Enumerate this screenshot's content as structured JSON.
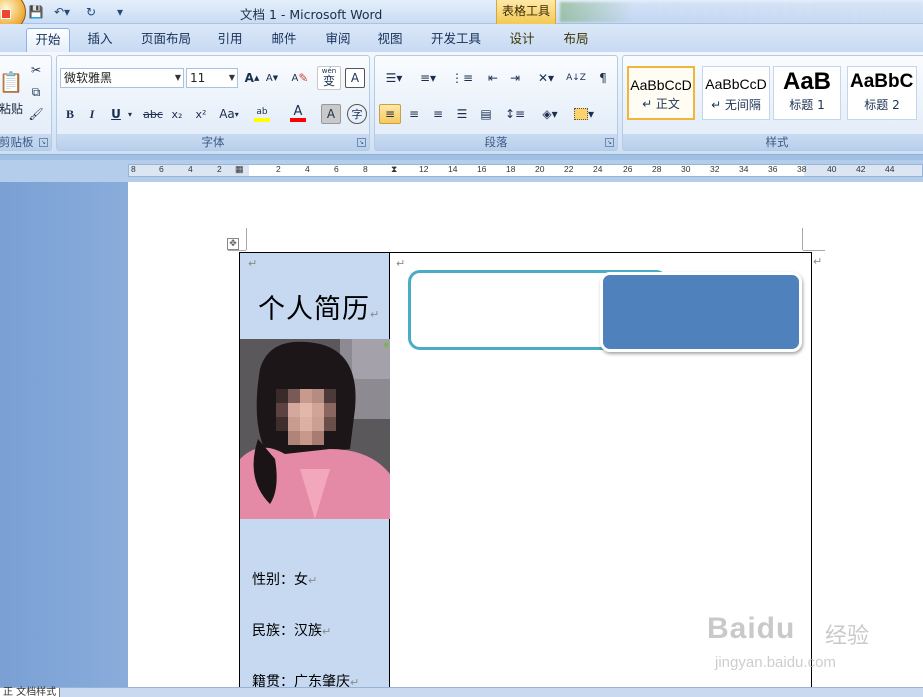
{
  "titlebar": {
    "doc_title": "文档 1 - Microsoft Word",
    "contextual_tab_group": "表格工具"
  },
  "tabs": {
    "items": [
      "开始",
      "插入",
      "页面布局",
      "引用",
      "邮件",
      "审阅",
      "视图",
      "开发工具",
      "设计",
      "布局"
    ],
    "active": "开始"
  },
  "clipboard": {
    "paste_label": "粘贴",
    "group_label": "剪贴板"
  },
  "font": {
    "font_name": "微软雅黑",
    "font_size": "11",
    "bold": "B",
    "italic": "I",
    "underline": "U",
    "strikethrough": "abc",
    "subscript": "x₂",
    "superscript": "x²",
    "change_case": "Aa",
    "grow": "A",
    "shrink": "A",
    "clear": "A",
    "wen": "wén",
    "bian": "变",
    "char_border": "A",
    "char_shade": "A",
    "enclose": "字",
    "highlight": "ab",
    "font_color": "A",
    "group_label": "字体"
  },
  "paragraph": {
    "group_label": "段落",
    "sort": "A↓Z",
    "pilcrow": "¶"
  },
  "styles": {
    "group_label": "样式",
    "cards": [
      {
        "sample": "AaBbCcD",
        "name": "↵ 正文",
        "selected": true
      },
      {
        "sample": "AaBbCcD",
        "name": "↵ 无间隔",
        "selected": false
      },
      {
        "sample": "AaB",
        "name": "标题 1",
        "selected": false
      },
      {
        "sample": "AaBbC",
        "name": "标题 2",
        "selected": false
      }
    ]
  },
  "ruler": {
    "left_numbers": [
      "8",
      "6",
      "4",
      "2"
    ],
    "right_numbers": [
      "2",
      "4",
      "6",
      "8",
      "10",
      "12",
      "14",
      "16",
      "18",
      "20",
      "22",
      "24",
      "26",
      "28",
      "30",
      "32",
      "34",
      "36",
      "38",
      "40",
      "42",
      "44"
    ]
  },
  "document": {
    "resume_title": "个人简历",
    "fields": [
      "性别：女",
      "民族：汉族",
      "籍贯：广东肇庆"
    ],
    "paragraph_mark": "↵",
    "table_move_handle": "✥"
  },
  "colors": {
    "left_column_fill": "#c6d9f1",
    "outline_shape_border": "#4bacc6",
    "filled_shape": "#4f81bd",
    "contextual_tab": "#f3c955"
  },
  "watermark": {
    "brand": "Baidu",
    "cn": "经验",
    "url": "jingyan.baidu.com"
  },
  "bottombar": {
    "item": "正 文档样式"
  }
}
